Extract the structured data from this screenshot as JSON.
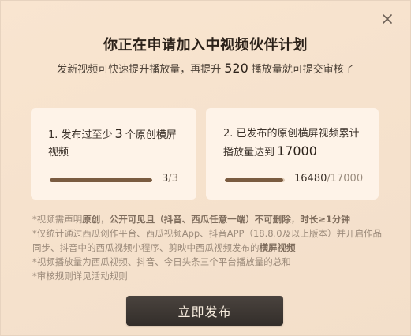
{
  "close_icon": "close-icon",
  "title": "你正在申请加入中视频伙伴计划",
  "subtitle": {
    "prefix": "发新视频可快速提升播放量，再提升",
    "number": "520",
    "suffix": "播放量就可提交审核了"
  },
  "requirements": [
    {
      "text_before": "1. 发布过至少",
      "highlight": "3",
      "text_after": "个原创横屏视频",
      "progress_current": "3",
      "progress_total": "/3",
      "progress_fraction": 1.0
    },
    {
      "text_before": "2. 已发布的原创横屏视频累计播放量达到",
      "highlight": "17000",
      "text_after": "",
      "progress_current": "16480",
      "progress_total": "/17000",
      "progress_fraction": 0.969
    }
  ],
  "notes": {
    "line1_a": "*视频需声明",
    "line1_b": "原创",
    "line1_c": "，",
    "line1_d": "公开可见且（抖音、西瓜任意一端）不可删除",
    "line1_e": "，",
    "line1_f": "时长≥1分钟",
    "line2_a": "*仅统计通过西瓜创作平台、西瓜视频App、抖音APP（18.8.0及以上版本）并开启作品同步、抖音中的西瓜视频小程序、剪映中西瓜视频发布的",
    "line2_b": "横屏视频",
    "line3": "*视频播放量为西瓜视频、抖音、今日头条三个平台播放量的总和",
    "line4": "*审核规则详见活动规则"
  },
  "cta_label": "立即发布",
  "colors": {
    "background": "#f6e2cd",
    "card": "#fff6ec",
    "progress_fill": "#7a5b40",
    "button": "#3b3531"
  }
}
